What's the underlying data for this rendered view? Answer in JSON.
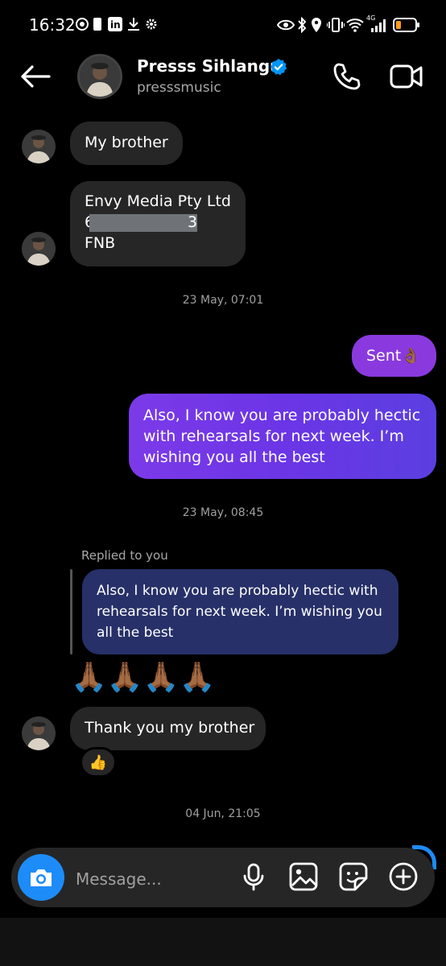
{
  "status_bar": {
    "time": "16:32",
    "network": "4G"
  },
  "header": {
    "name": "Presss Sihlangu",
    "username": "presssmusic"
  },
  "messages": {
    "m1": "My brother",
    "m2_line1": "Envy Media Pty Ltd",
    "m2_line2_tail": "3",
    "m2_line3": "FNB",
    "ts1": "23 May, 07:01",
    "sent": "Sent👌🏾",
    "m3": "Also, I know you are probably hectic with rehearsals for next week. I’m wishing you all the best",
    "ts2": "23 May, 08:45",
    "replied_label": "Replied to you",
    "reply_quote": "Also, I know you are probably hectic with rehearsals for next week. I’m wishing you all the best",
    "emoji_msg": "🙏🏾🙏🏾🙏🏾🙏🏾",
    "m4": "Thank you my brother",
    "reaction": "👍",
    "ts3": "04 Jun, 21:05"
  },
  "composer": {
    "placeholder": "Message..."
  }
}
